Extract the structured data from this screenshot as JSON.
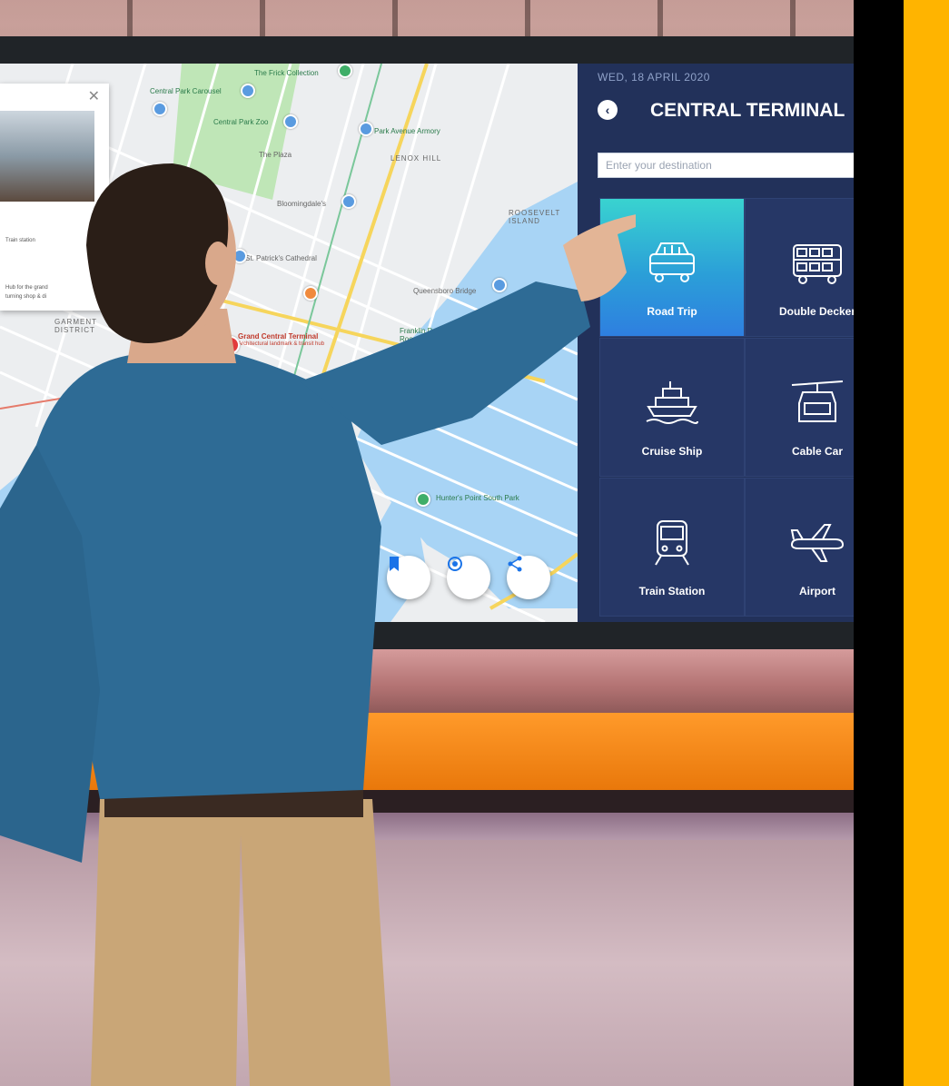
{
  "panel": {
    "date": "WED, 18 APRIL 2020",
    "title": "CENTRAL TERMINAL",
    "search_placeholder": "Enter your destination",
    "tiles": [
      {
        "label": "Road Trip",
        "icon": "bus-icon",
        "selected": true
      },
      {
        "label": "Double Decker",
        "icon": "double-decker-icon",
        "selected": false
      },
      {
        "label": "Cruise Ship",
        "icon": "cruise-ship-icon",
        "selected": false
      },
      {
        "label": "Cable Car",
        "icon": "cable-car-icon",
        "selected": false
      },
      {
        "label": "Train Station",
        "icon": "train-icon",
        "selected": false
      },
      {
        "label": "Airport",
        "icon": "airplane-icon",
        "selected": false
      }
    ]
  },
  "map": {
    "labels": {
      "frick": "The Frick Collection",
      "central_park_carousel": "Central Park Carousel",
      "central_park_zoo": "Central Park Zoo",
      "the_plaza": "The Plaza",
      "park_avenue_armory": "Park Avenue Armory",
      "lenox_hill": "LENOX HILL",
      "roosevelt_island": "ROOSEVELT ISLAND",
      "bloomingdales": "Bloomingdale's",
      "st_patricks": "St. Patrick's Cathedral",
      "queensboro_bridge": "Queensboro Bridge",
      "grand_central": "Grand Central Terminal",
      "grand_central_sub": "Architectural landmark & transit hub",
      "garment_district": "GARMENT DISTRICT",
      "four_freedoms": "Franklin D. Roosevelt Four Freedoms State Park",
      "hunters_point": "Hunter's Point South Park"
    },
    "info_card": {
      "subtitle": "Train station",
      "desc_line1": "Hub for the grand",
      "desc_line2": "turning shop & di"
    },
    "buttons": [
      "directions-icon",
      "bookmark-icon",
      "nearby-icon",
      "share-icon"
    ]
  },
  "colors": {
    "panel_bg": "#22315a",
    "tile_bg": "#263766",
    "tile_selected": "#2b9fd8",
    "frame_yellow": "#ffb400",
    "map_water": "#a8d4f5",
    "map_park": "#bfe6b7"
  }
}
